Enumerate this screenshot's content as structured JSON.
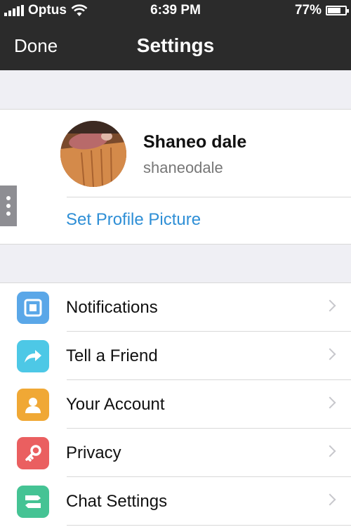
{
  "status_bar": {
    "carrier": "Optus",
    "time": "6:39 PM",
    "battery": "77%",
    "battery_level": 0.77
  },
  "nav": {
    "done_label": "Done",
    "title": "Settings"
  },
  "profile": {
    "name": "Shaneo dale",
    "username": "shaneodale",
    "set_picture_label": "Set Profile Picture"
  },
  "menu": {
    "items": [
      {
        "label": "Notifications",
        "icon": "notifications-icon",
        "color": "#5aa7e8"
      },
      {
        "label": "Tell a Friend",
        "icon": "share-arrow-icon",
        "color": "#4dc8e6"
      },
      {
        "label": "Your Account",
        "icon": "account-icon",
        "color": "#f0a835"
      },
      {
        "label": "Privacy",
        "icon": "key-icon",
        "color": "#ea5f60"
      },
      {
        "label": "Chat Settings",
        "icon": "chat-settings-icon",
        "color": "#45c394"
      }
    ]
  }
}
